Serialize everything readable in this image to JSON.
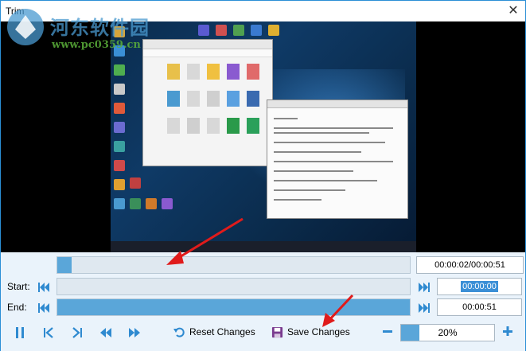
{
  "window": {
    "title": "Trim",
    "close_glyph": "✕"
  },
  "watermark": {
    "text": "河东软件园",
    "url": "www.pc0359.cn"
  },
  "timeline": {
    "time_display": "00:00:02/00:00:51",
    "progress_fraction": 0.04
  },
  "start": {
    "label": "Start:",
    "time": "00:00:00",
    "fill_fraction": 0.0
  },
  "end": {
    "label": "End:",
    "time": "00:00:51",
    "fill_fraction": 1.0
  },
  "toolbar": {
    "reset_label": "Reset Changes",
    "save_label": "Save Changes",
    "zoom_value": "20%",
    "zoom_fraction": 0.2
  },
  "icons": {
    "pause": "pause-icon",
    "prev_frame": "step-back-icon",
    "next_frame": "step-forward-icon",
    "rewind": "rewind-icon",
    "fast_forward": "fast-forward-icon",
    "reset": "undo-icon",
    "save": "floppy-disk-icon",
    "zoom_out": "minus-icon",
    "zoom_in": "plus-icon"
  },
  "colors": {
    "accent": "#2f8ad0",
    "fill": "#5aa6d9",
    "arrow": "#e01b1b",
    "panel": "#eaf3fb"
  }
}
